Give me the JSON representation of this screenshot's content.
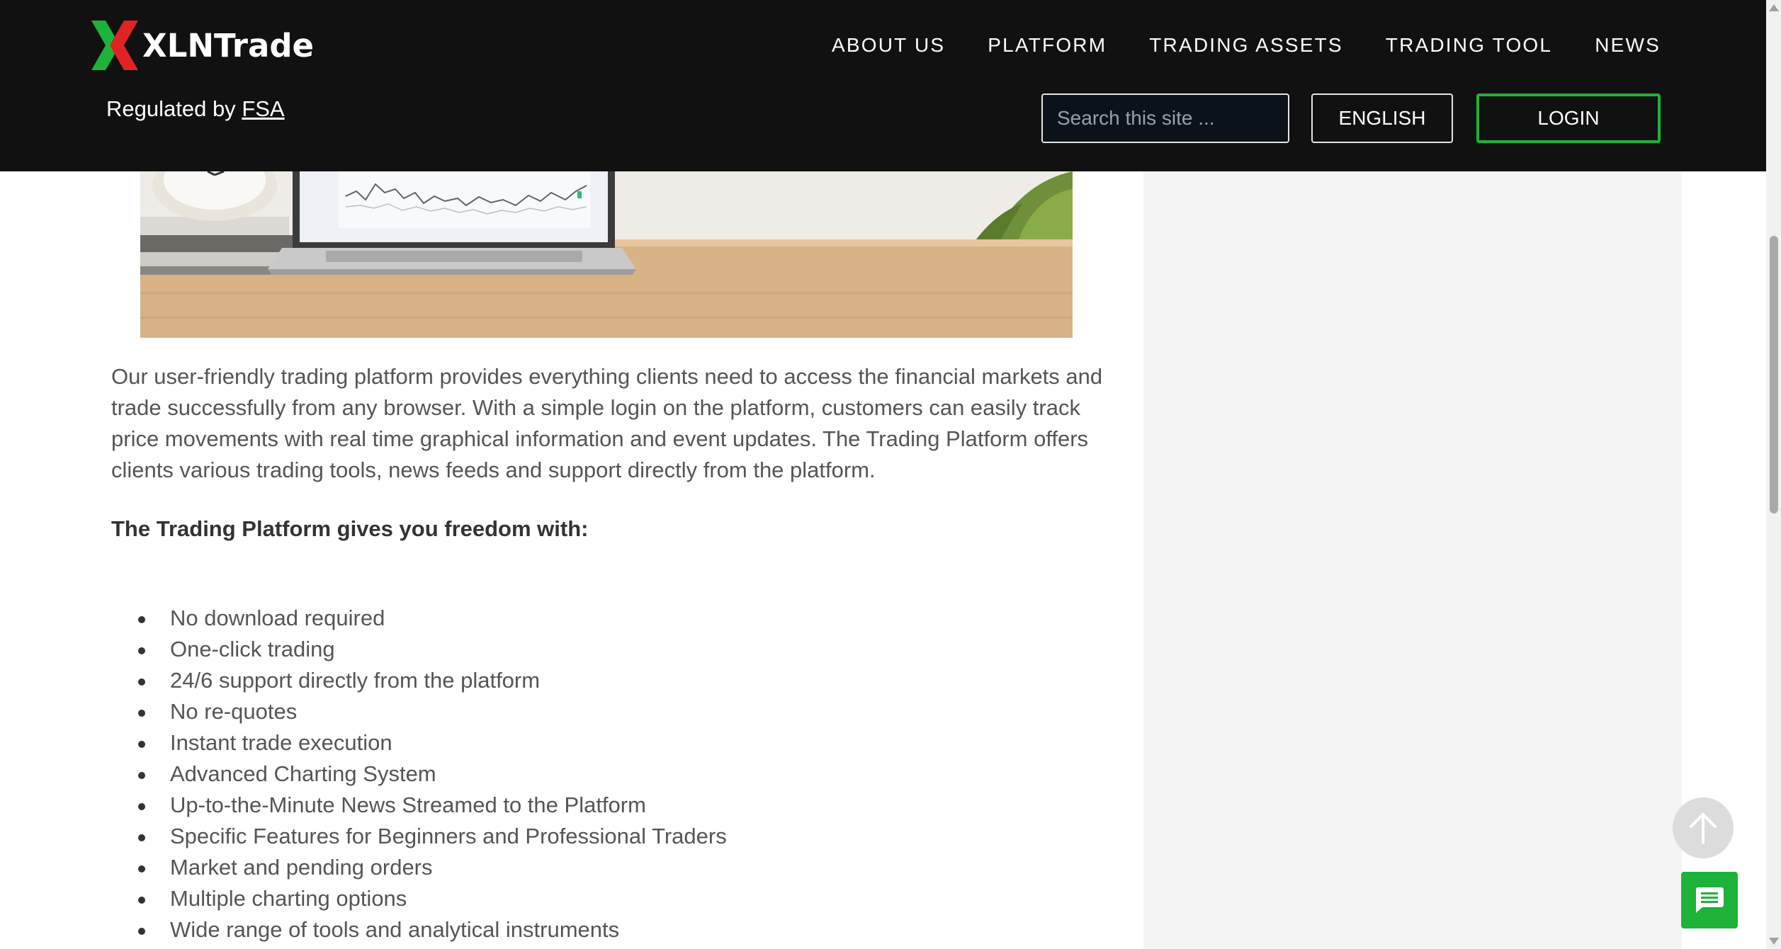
{
  "header": {
    "brand": "XLNTrade",
    "regulated_prefix": "Regulated by ",
    "regulated_link": "FSA",
    "nav": [
      {
        "label": "ABOUT US"
      },
      {
        "label": "PLATFORM"
      },
      {
        "label": "TRADING ASSETS"
      },
      {
        "label": "TRADING TOOL"
      },
      {
        "label": "NEWS"
      }
    ],
    "search_placeholder": "Search this site ...",
    "language_label": "ENGLISH",
    "login_label": "LOGIN"
  },
  "content": {
    "intro": "Our user-friendly trading platform provides everything clients need to access the financial markets and trade successfully from any browser. With a simple login on the platform, customers can easily track price movements with real time graphical information and event updates. The Trading Platform offers clients various trading tools, news feeds and support directly from the platform.",
    "subhead": "The Trading Platform gives you freedom with:",
    "features": [
      "No download required",
      "One-click trading",
      "24/6 support directly from the platform",
      "No re-quotes",
      "Instant trade execution",
      "Advanced Charting System",
      "Up-to-the-Minute News Streamed to the Platform",
      "Specific Features for Beginners and Professional Traders",
      "Market and pending orders",
      "Multiple charting options",
      "Wide range of tools and analytical instruments"
    ]
  },
  "colors": {
    "header_bg": "#111111",
    "accent_green": "#1db338",
    "logo_red": "#e02424",
    "sidebar_bg": "#f4f4f4"
  },
  "icons": {
    "search": "search-icon",
    "to_top": "arrow-up-icon",
    "chat": "chat-icon"
  }
}
